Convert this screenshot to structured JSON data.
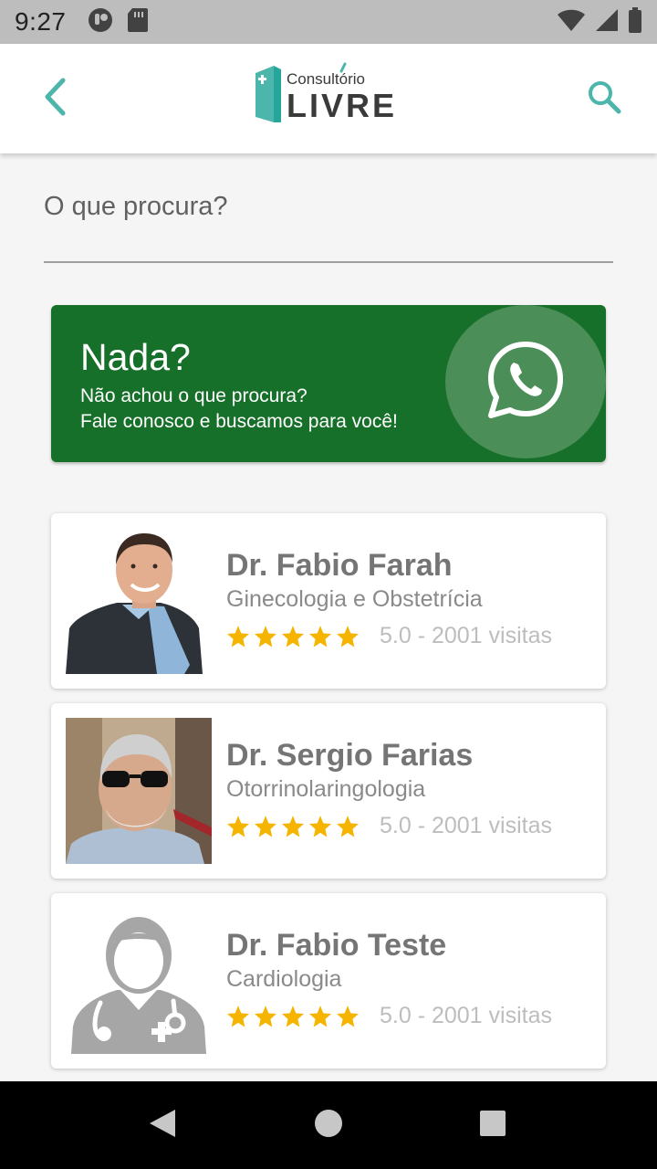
{
  "status_bar": {
    "time": "9:27",
    "icons": [
      "notification-icon",
      "sd-card-icon",
      "wifi-icon",
      "signal-icon",
      "battery-icon"
    ]
  },
  "app_bar": {
    "back_icon": "chevron-left-icon",
    "search_icon": "search-icon",
    "logo_text_top": "Consultório",
    "logo_text_bottom": "LIVRE"
  },
  "search": {
    "placeholder": "O que procura?",
    "value": ""
  },
  "promo": {
    "title": "Nada?",
    "line1": "Não achou o que procura?",
    "line2": "Fale conosco e buscamos para você!",
    "icon": "whatsapp-icon"
  },
  "doctors": [
    {
      "name": "Dr. Fabio Farah",
      "specialty": "Ginecologia e Obstetrícia",
      "rating": 5,
      "visits": "5.0 - 2001 visitas"
    },
    {
      "name": "Dr. Sergio Farias",
      "specialty": "Otorrinolaringologia",
      "rating": 5,
      "visits": "5.0 - 2001 visitas"
    },
    {
      "name": "Dr. Fabio Teste",
      "specialty": "Cardiologia",
      "rating": 5,
      "visits": "5.0 - 2001 visitas"
    }
  ],
  "colors": {
    "accent": "#4db6ac",
    "promo_bg": "#17702a",
    "star": "#f4b400"
  },
  "nav_bar": {
    "icons": [
      "back-triangle-icon",
      "home-circle-icon",
      "recents-square-icon"
    ]
  }
}
